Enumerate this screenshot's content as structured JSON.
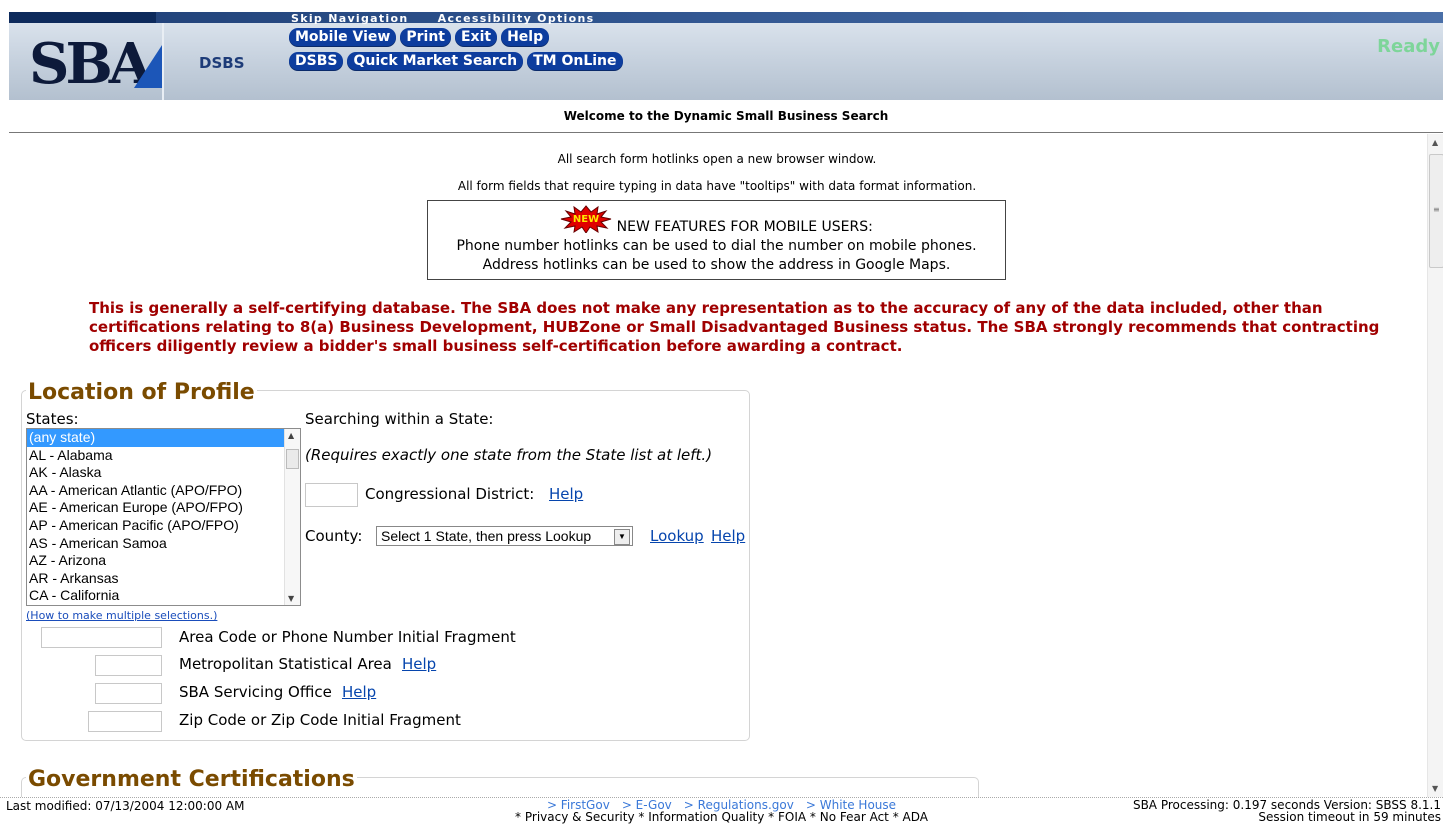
{
  "header": {
    "logo_text": "SBA",
    "app_label": "DSBS",
    "skip_links": [
      "Skip Navigation",
      "Accessibility Options"
    ],
    "nav_row1": [
      "Mobile View",
      "Print",
      "Exit",
      "Help"
    ],
    "nav_row2": [
      "DSBS",
      "Quick Market Search",
      "TM OnLine"
    ],
    "status": "Ready"
  },
  "welcome": "Welcome to the Dynamic Small Business Search",
  "notes": {
    "line1": "All search form hotlinks open a new browser window.",
    "line2": "All form fields that require typing in data have \"tooltips\" with data format information."
  },
  "new_features": {
    "badge": "NEW",
    "title": "NEW FEATURES FOR MOBILE USERS:",
    "line1": "Phone number hotlinks can be used to dial the number on mobile phones.",
    "line2": "Address hotlinks can be used to show the address in Google Maps."
  },
  "disclaimer": "This is generally a self-certifying database. The SBA does not make any representation as to the accuracy of any of the data included, other than certifications relating to 8(a) Business Development, HUBZone or Small Disadvantaged Business status. The SBA strongly recommends that contracting officers diligently review a bidder's small business self-certification before awarding a contract.",
  "location": {
    "legend": "Location of Profile",
    "states_label": "States:",
    "states": [
      "(any state)",
      "AL - Alabama",
      "AK - Alaska",
      "AA - American Atlantic (APO/FPO)",
      "AE - American Europe (APO/FPO)",
      "AP - American Pacific (APO/FPO)",
      "AS - American Samoa",
      "AZ - Arizona",
      "AR - Arkansas",
      "CA - California"
    ],
    "multi_select_help": "(How to make multiple selections.)",
    "within_state": "Searching within a State:",
    "requires_note": "(Requires exactly one state from the State list at left.)",
    "congressional": "Congressional District:",
    "help": "Help",
    "county_label": "County:",
    "county_value": "Select 1 State, then press Lookup",
    "lookup": "Lookup",
    "area_code": "Area Code or Phone Number Initial Fragment",
    "msa": "Metropolitan Statistical Area",
    "servicing": "SBA Servicing Office",
    "zip": "Zip Code or Zip Code Initial Fragment"
  },
  "gov_cert": {
    "legend": "Government Certifications"
  },
  "footer": {
    "last_modified": "Last modified: 07/13/2004 12:00:00 AM",
    "links": [
      "> FirstGov",
      "> E-Gov",
      "> Regulations.gov",
      "> White House"
    ],
    "policy": "* Privacy & Security  * Information Quality  * FOIA  * No Fear Act  * ADA",
    "processing": "SBA Processing:  0.197 seconds Version: SBSS 8.1.1",
    "timeout": "Session timeout in 59 minutes"
  }
}
